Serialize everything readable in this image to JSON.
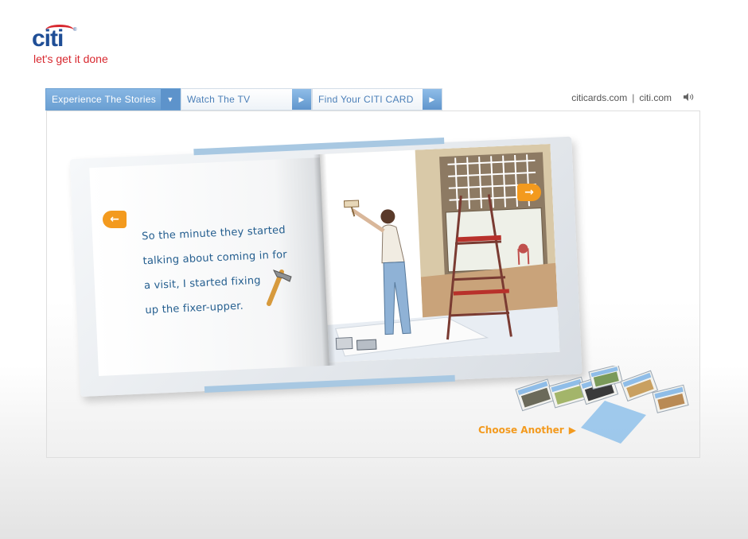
{
  "brand": {
    "logo_text": "citi",
    "tagline": "let's get it done",
    "accent": "#d8282f",
    "brand_blue": "#1f4e96"
  },
  "nav": {
    "tabs": [
      {
        "label": "Experience The Stories",
        "icon": "chevron-down-icon",
        "active": true
      },
      {
        "label": "Watch The TV",
        "icon": "play-triangle-icon",
        "active": false
      },
      {
        "label": "Find Your CITI CARD",
        "icon": "play-triangle-icon",
        "active": false
      }
    ]
  },
  "toplinks": {
    "link1": "citicards.com",
    "separator": "|",
    "link2": "citi.com",
    "sound_icon": "speaker-icon"
  },
  "story": {
    "lines": [
      "So the minute they started",
      "talking about coming in for",
      "a visit, I started fixing",
      "up the fixer-upper."
    ],
    "prev_icon": "arrow-left-icon",
    "next_icon": "arrow-right-icon",
    "illustration": "woman-painting-wall-with-ladder",
    "text_color": "#245e8f"
  },
  "choose": {
    "label": "Choose Another",
    "accent": "#f39a1e"
  }
}
